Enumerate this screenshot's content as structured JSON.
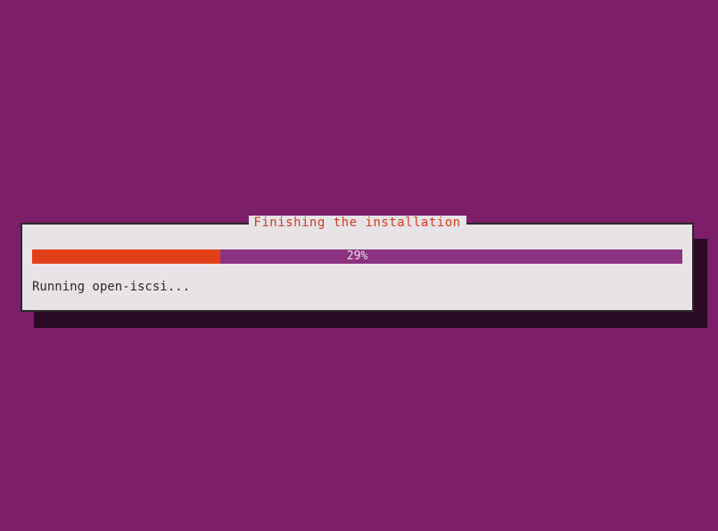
{
  "dialog": {
    "title": "Finishing the installation",
    "progress_percent": "29%",
    "progress_value": 29,
    "status": "Running open-iscsi..."
  }
}
